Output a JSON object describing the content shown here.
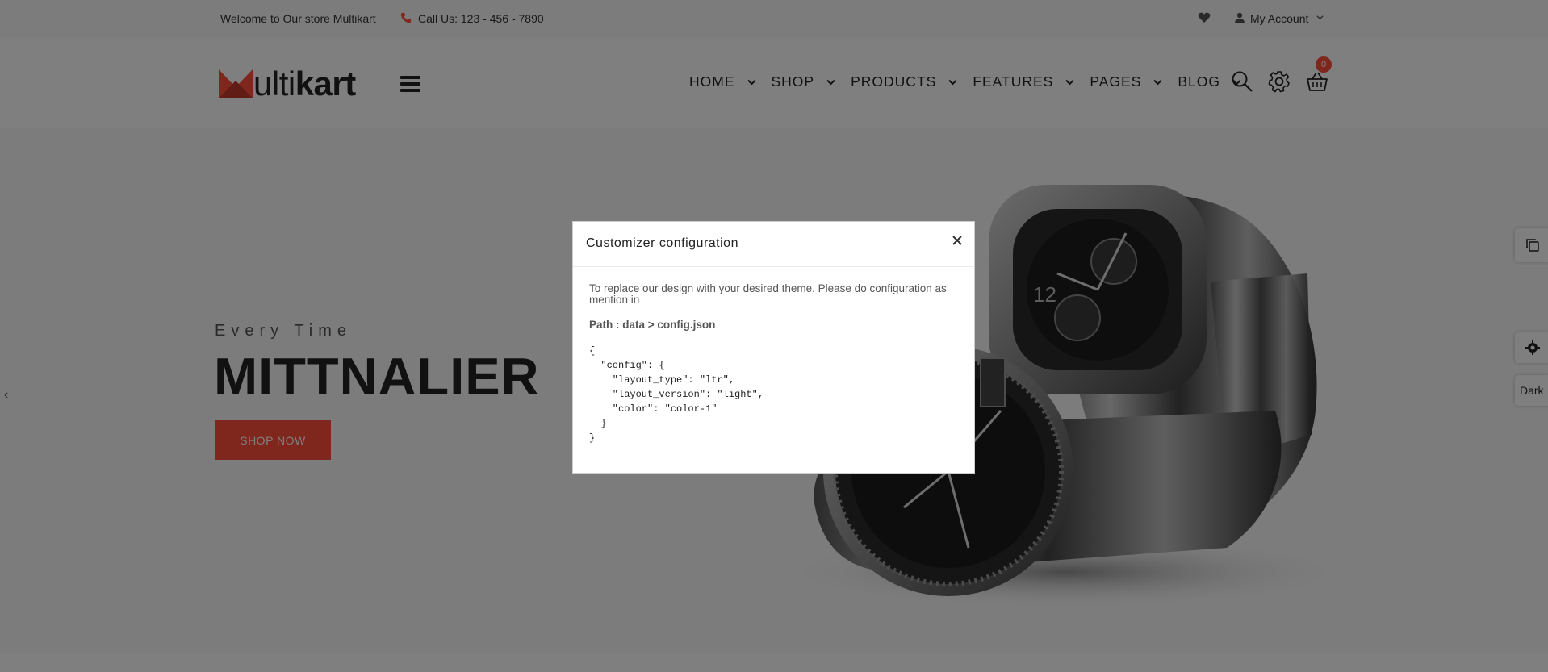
{
  "topbar": {
    "welcome": "Welcome to Our store Multikart",
    "phone": "Call Us: 123 - 456 - 7890",
    "account": "My Account"
  },
  "header": {
    "logo_plain": "ulti",
    "logo_bold": "kart",
    "nav": [
      "HOME",
      "SHOP",
      "PRODUCTS",
      "FEATURES",
      "PAGES",
      "BLOG"
    ],
    "cart_count": "0"
  },
  "hero": {
    "eyebrow": "Every Time",
    "headline": "MITTNALIER",
    "cta": "SHOP NOW",
    "prev_arrow": "‹"
  },
  "side": {
    "dark_label": "Dark"
  },
  "modal": {
    "title": "Customizer configuration",
    "description": "To replace our design with your desired theme. Please do configuration as mention in",
    "path": "Path : data > config.json",
    "code": "{\n  \"config\": {\n    \"layout_type\": \"ltr\",\n    \"layout_version\": \"light\",\n    \"color\": \"color-1\"\n  }\n}"
  },
  "colors": {
    "accent": "#ff4c3b",
    "overlay": "rgba(0,0,0,0.5)"
  }
}
